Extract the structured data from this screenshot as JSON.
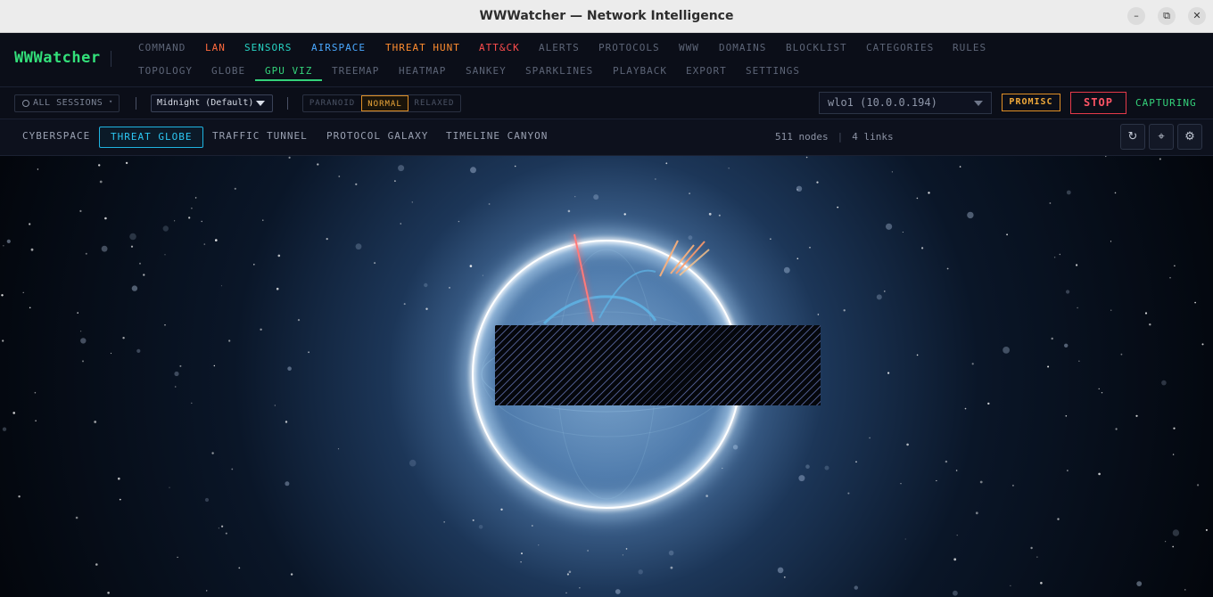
{
  "window": {
    "title": "WWWatcher — Network Intelligence",
    "controls": [
      "–",
      "⧉",
      "✕"
    ]
  },
  "app": {
    "brand": "WWWatcher"
  },
  "nav": {
    "row1": [
      "COMMAND",
      "LAN",
      "SENSORS",
      "AIRSPACE",
      "THREAT HUNT",
      "ATT&CK",
      "ALERTS",
      "PROTOCOLS",
      "WWW",
      "DOMAINS",
      "BLOCKLIST",
      "CATEGORIES",
      "RULES"
    ],
    "row2": [
      "TOPOLOGY",
      "GLOBE",
      "GPU VIZ",
      "TREEMAP",
      "HEATMAP",
      "SANKEY",
      "SPARKLINES",
      "PLAYBACK",
      "EXPORT",
      "SETTINGS"
    ],
    "active": "GPU VIZ"
  },
  "toolbar": {
    "sessions_label": "ALL SESSIONS",
    "sessions_caret": "▾",
    "theme": "Midnight (Default)",
    "modes": [
      "PARANOID",
      "NORMAL",
      "RELAXED"
    ],
    "active_mode": "NORMAL",
    "interface": "wlo1 (10.0.0.194)",
    "promisc_label": "PROMISC",
    "stop_label": "STOP",
    "status": "CAPTURING"
  },
  "viz_tabs": [
    "CYBERSPACE",
    "THREAT GLOBE",
    "TRAFFIC TUNNEL",
    "PROTOCOL GALAXY",
    "TIMELINE CANYON"
  ],
  "active_viz_tab": "THREAT GLOBE",
  "stats": {
    "nodes": "511 nodes",
    "links": "4 links"
  },
  "view_controls": [
    {
      "name": "reset-view-icon",
      "glyph": "↻"
    },
    {
      "name": "center-view-icon",
      "glyph": "⌖"
    },
    {
      "name": "settings-gear-icon",
      "glyph": "⚙"
    }
  ],
  "colors": {
    "accent_green": "#34d27a",
    "accent_cyan": "#2cc6f2",
    "threat_red": "#ff5566",
    "warning_orange": "#f0a93a",
    "nav_lan": "#ff6a3d",
    "nav_sensors": "#27d3c3",
    "nav_airspace": "#4aa8ff",
    "nav_threat_hunt": "#ff8c2e",
    "nav_attck": "#ff4d4d"
  }
}
